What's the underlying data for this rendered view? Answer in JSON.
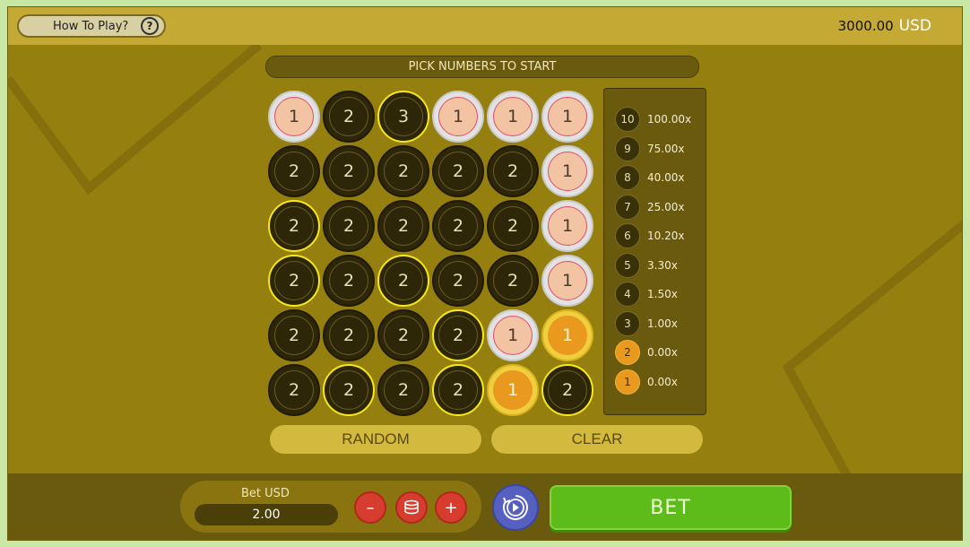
{
  "header": {
    "how_to_play": "How To Play?",
    "help_glyph": "?",
    "balance_amount": "3000.00",
    "balance_currency": "USD"
  },
  "board": {
    "title": "PICK NUMBERS TO START",
    "chips": [
      {
        "v": "1",
        "s": "pink"
      },
      {
        "v": "2",
        "s": "dark"
      },
      {
        "v": "3",
        "s": "dark-sel"
      },
      {
        "v": "1",
        "s": "pink"
      },
      {
        "v": "1",
        "s": "pink"
      },
      {
        "v": "1",
        "s": "pink"
      },
      {
        "v": "2",
        "s": "dark"
      },
      {
        "v": "2",
        "s": "dark"
      },
      {
        "v": "2",
        "s": "dark"
      },
      {
        "v": "2",
        "s": "dark"
      },
      {
        "v": "2",
        "s": "dark"
      },
      {
        "v": "1",
        "s": "pink"
      },
      {
        "v": "2",
        "s": "dark-sel"
      },
      {
        "v": "2",
        "s": "dark"
      },
      {
        "v": "2",
        "s": "dark"
      },
      {
        "v": "2",
        "s": "dark"
      },
      {
        "v": "2",
        "s": "dark"
      },
      {
        "v": "1",
        "s": "pink"
      },
      {
        "v": "2",
        "s": "dark-sel"
      },
      {
        "v": "2",
        "s": "dark"
      },
      {
        "v": "2",
        "s": "dark-sel"
      },
      {
        "v": "2",
        "s": "dark"
      },
      {
        "v": "2",
        "s": "dark"
      },
      {
        "v": "1",
        "s": "pink"
      },
      {
        "v": "2",
        "s": "dark"
      },
      {
        "v": "2",
        "s": "dark"
      },
      {
        "v": "2",
        "s": "dark"
      },
      {
        "v": "2",
        "s": "dark-sel"
      },
      {
        "v": "1",
        "s": "pink"
      },
      {
        "v": "1",
        "s": "gold"
      },
      {
        "v": "2",
        "s": "dark"
      },
      {
        "v": "2",
        "s": "dark-sel"
      },
      {
        "v": "2",
        "s": "dark"
      },
      {
        "v": "2",
        "s": "dark-sel"
      },
      {
        "v": "1",
        "s": "gold"
      },
      {
        "v": "2",
        "s": "dark-sel"
      }
    ],
    "random_label": "RANDOM",
    "clear_label": "CLEAR"
  },
  "paytable": [
    {
      "hits": "10",
      "mult": "100.00x",
      "active": false
    },
    {
      "hits": "9",
      "mult": "75.00x",
      "active": false
    },
    {
      "hits": "8",
      "mult": "40.00x",
      "active": false
    },
    {
      "hits": "7",
      "mult": "25.00x",
      "active": false
    },
    {
      "hits": "6",
      "mult": "10.20x",
      "active": false
    },
    {
      "hits": "5",
      "mult": "3.30x",
      "active": false
    },
    {
      "hits": "4",
      "mult": "1.50x",
      "active": false
    },
    {
      "hits": "3",
      "mult": "1.00x",
      "active": false
    },
    {
      "hits": "2",
      "mult": "0.00x",
      "active": true
    },
    {
      "hits": "1",
      "mult": "0.00x",
      "active": true
    }
  ],
  "footer": {
    "bet_label": "Bet  USD",
    "bet_value": "2.00",
    "minus": "–",
    "plus": "+",
    "bet_button": "BET"
  },
  "colors": {
    "background": "#957f0f",
    "topbar": "#c4a934",
    "bet_button": "#5dbb1a",
    "chip_dark": "#2d2608",
    "chip_selected_ring": "#f4e81c",
    "chip_pink": "#f2c4a4",
    "chip_gold": "#e8991e",
    "minus_plus": "#d63d2e",
    "autoplay": "#5560c0"
  }
}
